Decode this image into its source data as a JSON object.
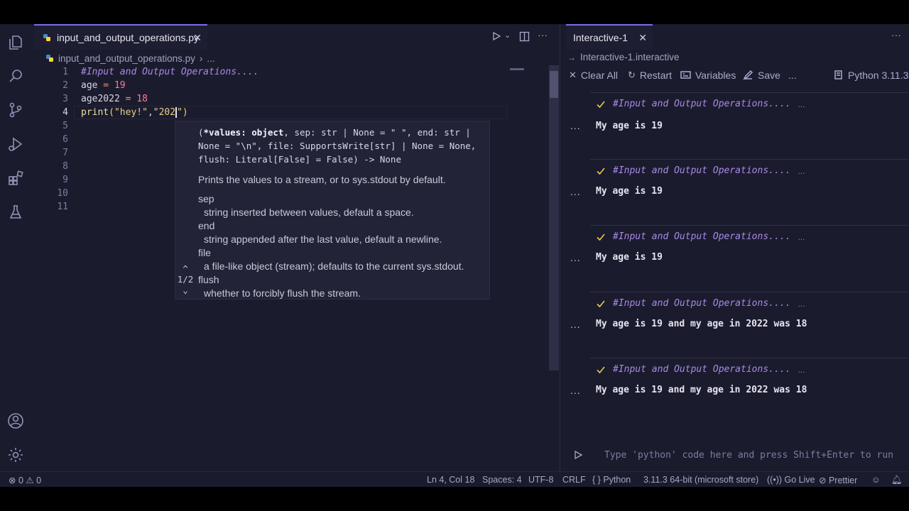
{
  "editor": {
    "tab_label": "input_and_output_operations.py",
    "breadcrumb_file": "input_and_output_operations.py",
    "breadcrumb_more": "...",
    "line_numbers": [
      "1",
      "2",
      "3",
      "4",
      "5",
      "6",
      "7",
      "8",
      "9",
      "10",
      "11"
    ],
    "code": {
      "l1_comment": "#Input and Output Operations....",
      "l2_var": "age",
      "l2_op": " = ",
      "l2_val": "19",
      "l3_var": "age2022",
      "l3_op": " = ",
      "l3_val": "18",
      "l4_fn": "print",
      "l4_open": "(",
      "l4_str1": "\"hey!\"",
      "l4_comma": ",",
      "l4_str2": "\"202",
      "l4_str2_end": "\"",
      "l4_close": ")"
    }
  },
  "hover": {
    "sig_open": "(",
    "sig_bold": "*values: object",
    "sig_rest": ", sep: str | None = \" \", end: str | None = \"\\n\", file: SupportsWrite[str] | None = None, flush: Literal[False] = False) -> None",
    "description": "Prints the values to a stream, or to sys.stdout by default.",
    "params": [
      {
        "name": "sep",
        "desc": "string inserted between values, default a space."
      },
      {
        "name": "end",
        "desc": "string appended after the last value, default a newline."
      },
      {
        "name": "file",
        "desc": "a file-like object (stream); defaults to the current sys.stdout."
      },
      {
        "name": "flush",
        "desc": "whether to forcibly flush the stream."
      }
    ],
    "overload_counter": "1/2"
  },
  "interactive": {
    "tab_label": "Interactive-1",
    "breadcrumb": "Interactive-1.interactive",
    "toolbar": {
      "clear_all": "Clear All",
      "restart": "Restart",
      "variables": "Variables",
      "save": "Save",
      "more": "...",
      "kernel": "Python 3.11.3"
    },
    "cells": [
      {
        "code": "#Input and Output Operations....",
        "output": "My age is 19"
      },
      {
        "code": "#Input and Output Operations....",
        "output": "My age is 19"
      },
      {
        "code": "#Input and Output Operations....",
        "output": "My age is 19"
      },
      {
        "code": "#Input and Output Operations....",
        "output": "My age is 19 and my age in 2022 was 18"
      },
      {
        "code": "#Input and Output Operations....",
        "output": "My age is 19 and my age in 2022 was 18"
      }
    ],
    "cell_more": "...",
    "output_dots": "...",
    "input_placeholder": "Type 'python' code here and press Shift+Enter to run"
  },
  "statusbar": {
    "errors": "0",
    "warnings": "0",
    "position": "Ln 4, Col 18",
    "spaces": "Spaces: 4",
    "encoding": "UTF-8",
    "eol": "CRLF",
    "language_braces": "{ }",
    "language": "Python",
    "interpreter": "3.11.3 64-bit (microsoft store)",
    "go_live": "Go Live",
    "prettier": "Prettier"
  },
  "colors": {
    "accent": "#7a6cf0",
    "background": "#1b1b2e",
    "comment": "#a98be6",
    "number": "#ff7a9a",
    "string": "#e3d28a",
    "check": "#e7c94a"
  }
}
